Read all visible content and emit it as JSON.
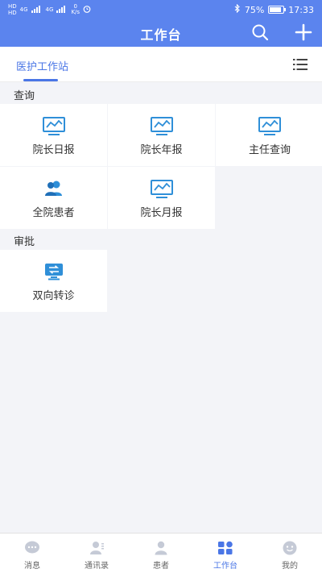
{
  "status_bar": {
    "hd1": "HD",
    "hd2": "HD",
    "network1": "4G",
    "network2": "4G",
    "speed_value": "0",
    "speed_unit": "K/s",
    "battery_percent": "75%",
    "battery_level": 0.75,
    "time": "17:33"
  },
  "header": {
    "title": "工作台"
  },
  "tabs": {
    "active_label": "医护工作站"
  },
  "sections": {
    "query_label": "查询",
    "approval_label": "审批"
  },
  "query_items": [
    {
      "label": "院长日报",
      "icon": "monitor-chart-icon"
    },
    {
      "label": "院长年报",
      "icon": "monitor-chart-icon"
    },
    {
      "label": "主任查询",
      "icon": "monitor-chart-icon"
    },
    {
      "label": "全院患者",
      "icon": "users-icon"
    },
    {
      "label": "院长月报",
      "icon": "monitor-chart-icon"
    }
  ],
  "approval_items": [
    {
      "label": "双向转诊",
      "icon": "transfer-icon"
    }
  ],
  "bottom_nav": [
    {
      "label": "消息",
      "icon": "chat-bubble-icon",
      "active": false
    },
    {
      "label": "通讯录",
      "icon": "contacts-icon",
      "active": false
    },
    {
      "label": "患者",
      "icon": "person-icon",
      "active": false
    },
    {
      "label": "工作台",
      "icon": "workbench-icon",
      "active": true
    },
    {
      "label": "我的",
      "icon": "smiley-icon",
      "active": false
    }
  ],
  "colors": {
    "primary": "#5b84ee",
    "accent": "#4a76e6",
    "icon_blue": "#2f8fd8",
    "nav_inactive": "#c5cad6"
  }
}
